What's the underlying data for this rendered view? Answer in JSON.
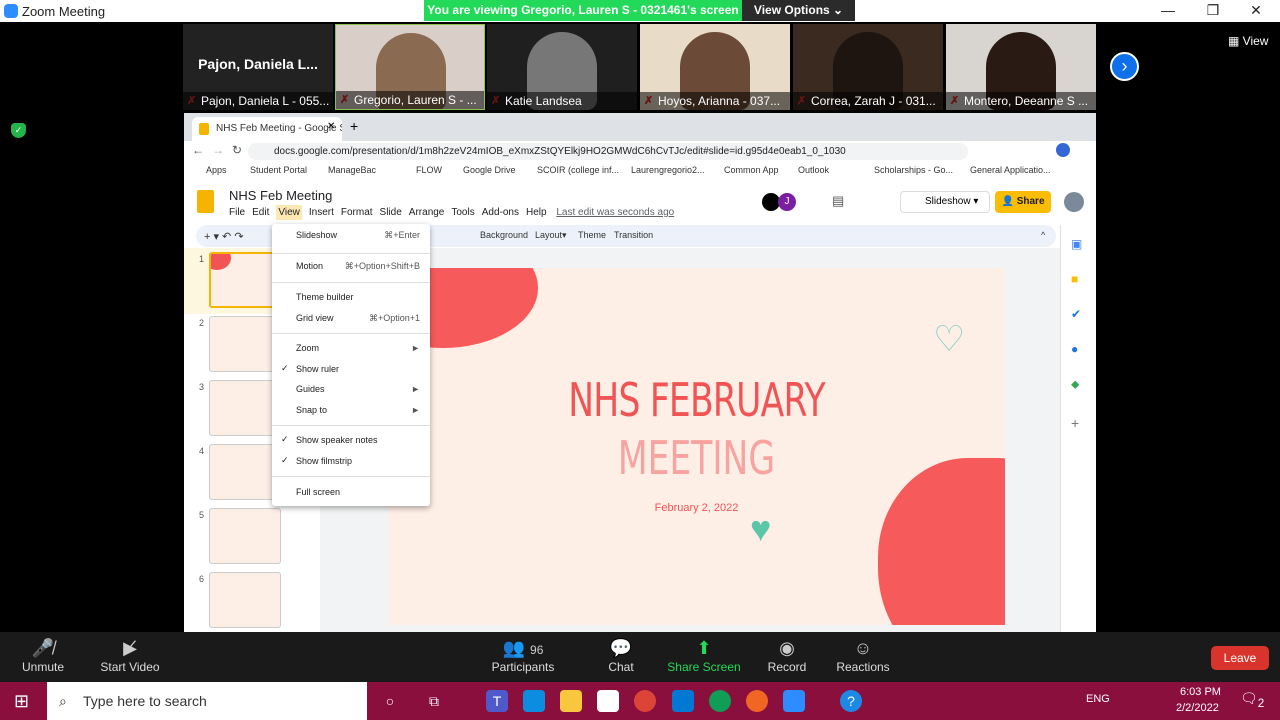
{
  "window": {
    "title": "Zoom Meeting",
    "banner": "You are viewing Gregorio, Lauren S - 0321461's screen",
    "view_options": "View Options ⌄",
    "view": "View"
  },
  "participants": [
    {
      "big": "Pajon,  Daniela  L...",
      "name": "Pajon, Daniela L - 055..."
    },
    {
      "name": "Gregorio, Lauren S - ..."
    },
    {
      "name": "Katie Landsea"
    },
    {
      "name": "Hoyos, Arianna - 037..."
    },
    {
      "name": "Correa, Zarah J - 031..."
    },
    {
      "name": "Montero, Deeanne S ..."
    }
  ],
  "browser": {
    "tab": "NHS Feb Meeting - Google Sli",
    "url": "docs.google.com/presentation/d/1m8h2zeV24mIOB_eXmxZStQYElkj9HO2GMWdC6hCvTJc/edit#slide=id.g95d4e0eab1_0_1030",
    "bookmarks": [
      "Apps",
      "Student Portal",
      "ManageBac",
      "FLOW",
      "Google Drive",
      "SCOIR (college inf...",
      "Laurengregorio2...",
      "Common App",
      "Outlook",
      "Scholarships - Go...",
      "General Applicatio..."
    ]
  },
  "slides": {
    "title": "NHS Feb Meeting",
    "menus": [
      "File",
      "Edit",
      "View",
      "Insert",
      "Format",
      "Slide",
      "Arrange",
      "Tools",
      "Add-ons",
      "Help"
    ],
    "last_edit": "Last edit was seconds ago",
    "slideshow": "Slideshow",
    "share": "Share",
    "avatar_j": "J",
    "toolbar": [
      "Background",
      "Layout▾",
      "Theme",
      "Transition"
    ],
    "slide_numbers": [
      "1",
      "2",
      "3",
      "4",
      "5",
      "6"
    ],
    "slide": {
      "title": "NHS FEBRUARY",
      "subtitle": "MEETING",
      "date": "February 2, 2022"
    }
  },
  "view_menu": [
    {
      "label": "Slideshow",
      "key": "⌘+Enter"
    },
    {
      "label": "Motion",
      "key": "⌘+Option+Shift+B"
    },
    {
      "label": "Theme builder"
    },
    {
      "label": "Grid view",
      "key": "⌘+Option+1"
    },
    {
      "label": "Zoom",
      "sub": "►"
    },
    {
      "label": "Show ruler",
      "check": "✓"
    },
    {
      "label": "Guides",
      "sub": "►"
    },
    {
      "label": "Snap to",
      "sub": "►"
    },
    {
      "label": "Show speaker notes",
      "check": "✓"
    },
    {
      "label": "Show filmstrip",
      "check": "✓"
    },
    {
      "label": "Full screen"
    }
  ],
  "zoom_toolbar": {
    "unmute": "Unmute",
    "start_video": "Start Video",
    "participants": "Participants",
    "participants_count": "96",
    "chat": "Chat",
    "share_screen": "Share Screen",
    "record": "Record",
    "reactions": "Reactions",
    "leave": "Leave"
  },
  "taskbar": {
    "search_placeholder": "Type here to search",
    "lang": "ENG",
    "time": "6:03 PM",
    "date": "2/2/2022",
    "notif_count": "2"
  }
}
